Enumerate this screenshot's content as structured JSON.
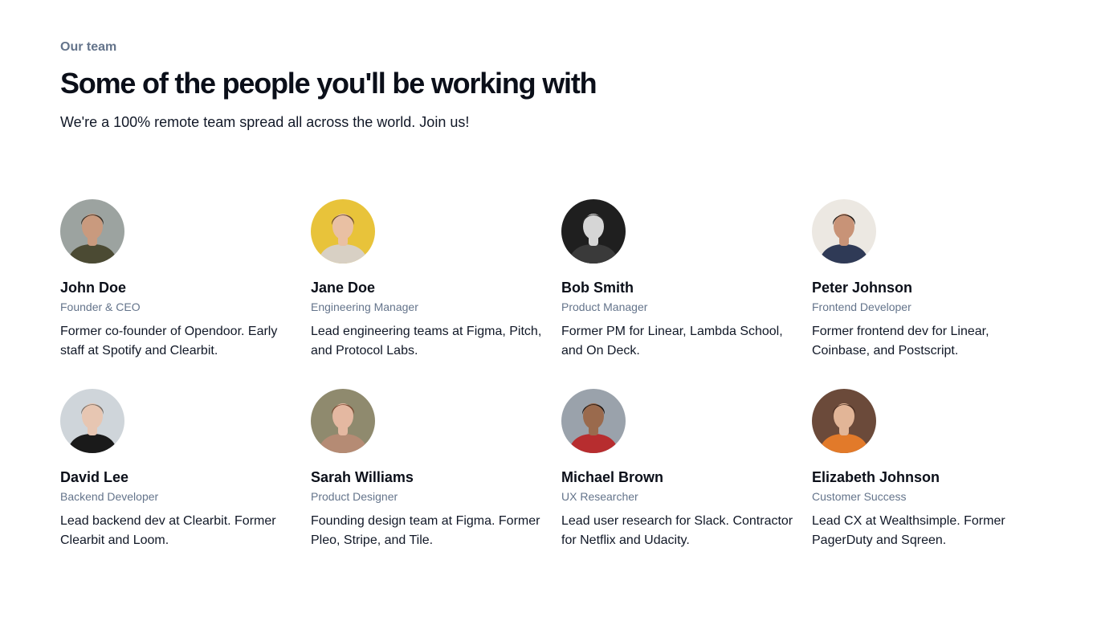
{
  "header": {
    "eyebrow": "Our team",
    "title": "Some of the people you'll be working with",
    "subtitle": "We're a 100% remote team spread all across the world. Join us!"
  },
  "members": [
    {
      "name": "John Doe",
      "role": "Founder & CEO",
      "bio": "Former co-founder of Opendoor. Early staff at Spotify and Clearbit.",
      "avatar": {
        "bg": "#9ca3a0",
        "skin": "#c99a7e",
        "hair": "#3b3027",
        "shirt": "#4b4a33"
      }
    },
    {
      "name": "Jane Doe",
      "role": "Engineering Manager",
      "bio": "Lead engineering teams at Figma, Pitch, and Protocol Labs.",
      "avatar": {
        "bg": "#e8c33a",
        "skin": "#e9c0a3",
        "hair": "#6b4a36",
        "shirt": "#d8d0c4"
      }
    },
    {
      "name": "Bob Smith",
      "role": "Product Manager",
      "bio": "Former PM for Linear, Lambda School, and On Deck.",
      "avatar": {
        "bg": "#1f1f1f",
        "skin": "#d6d6d6",
        "hair": "#2a2a2a",
        "shirt": "#3a3a3a"
      }
    },
    {
      "name": "Peter Johnson",
      "role": "Frontend Developer",
      "bio": "Former frontend dev for Linear, Coinbase, and Postscript.",
      "avatar": {
        "bg": "#ece8e2",
        "skin": "#c89377",
        "hair": "#1f1a17",
        "shirt": "#2f3a56"
      }
    },
    {
      "name": "David Lee",
      "role": "Backend Developer",
      "bio": "Lead backend dev at Clearbit. Former Clearbit and Loom.",
      "avatar": {
        "bg": "#cfd5da",
        "skin": "#e7c6b2",
        "hair": "#7a6f66",
        "shirt": "#1a1a1a"
      }
    },
    {
      "name": "Sarah Williams",
      "role": "Product Designer",
      "bio": "Founding design team at Figma. Former Pleo, Stripe, and Tile.",
      "avatar": {
        "bg": "#8f8a6e",
        "skin": "#e4b8a1",
        "hair": "#7a4a32",
        "shirt": "#b58b74"
      }
    },
    {
      "name": "Michael Brown",
      "role": "UX Researcher",
      "bio": "Lead user research for Slack. Contractor for Netflix and Udacity.",
      "avatar": {
        "bg": "#9aa2ab",
        "skin": "#9a6a4d",
        "hair": "#1b1411",
        "shirt": "#b72d2f"
      }
    },
    {
      "name": "Elizabeth Johnson",
      "role": "Customer Success",
      "bio": "Lead CX at Wealthsimple. Former PagerDuty and Sqreen.",
      "avatar": {
        "bg": "#6b4a3a",
        "skin": "#e2b597",
        "hair": "#4a2e22",
        "shirt": "#e27a2a"
      }
    }
  ]
}
